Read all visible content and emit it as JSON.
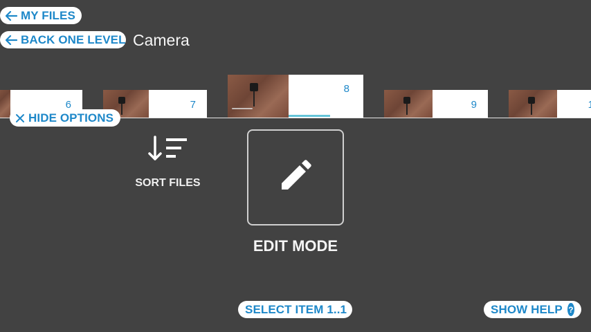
{
  "nav": {
    "my_files": "MY FILES",
    "back_one_level": "BACK ONE LEVEL",
    "folder_title": "Camera"
  },
  "thumbnails": [
    {
      "number": "6"
    },
    {
      "number": "7"
    },
    {
      "number": "8"
    },
    {
      "number": "9"
    },
    {
      "number": "1"
    }
  ],
  "options": {
    "hide_options": "HIDE OPTIONS",
    "sort_files": "SORT FILES",
    "edit_mode": "EDIT MODE"
  },
  "footer": {
    "select_item": "SELECT ITEM 1..1",
    "show_help": "SHOW HELP",
    "help_badge": "?"
  },
  "colors": {
    "background": "#424242",
    "accent": "#1e88c9",
    "pill": "#ffffff"
  },
  "icons": {
    "back_arrow": "arrow-left-icon",
    "close": "close-icon",
    "sort": "sort-icon",
    "edit": "pencil-icon",
    "help": "question-icon"
  }
}
